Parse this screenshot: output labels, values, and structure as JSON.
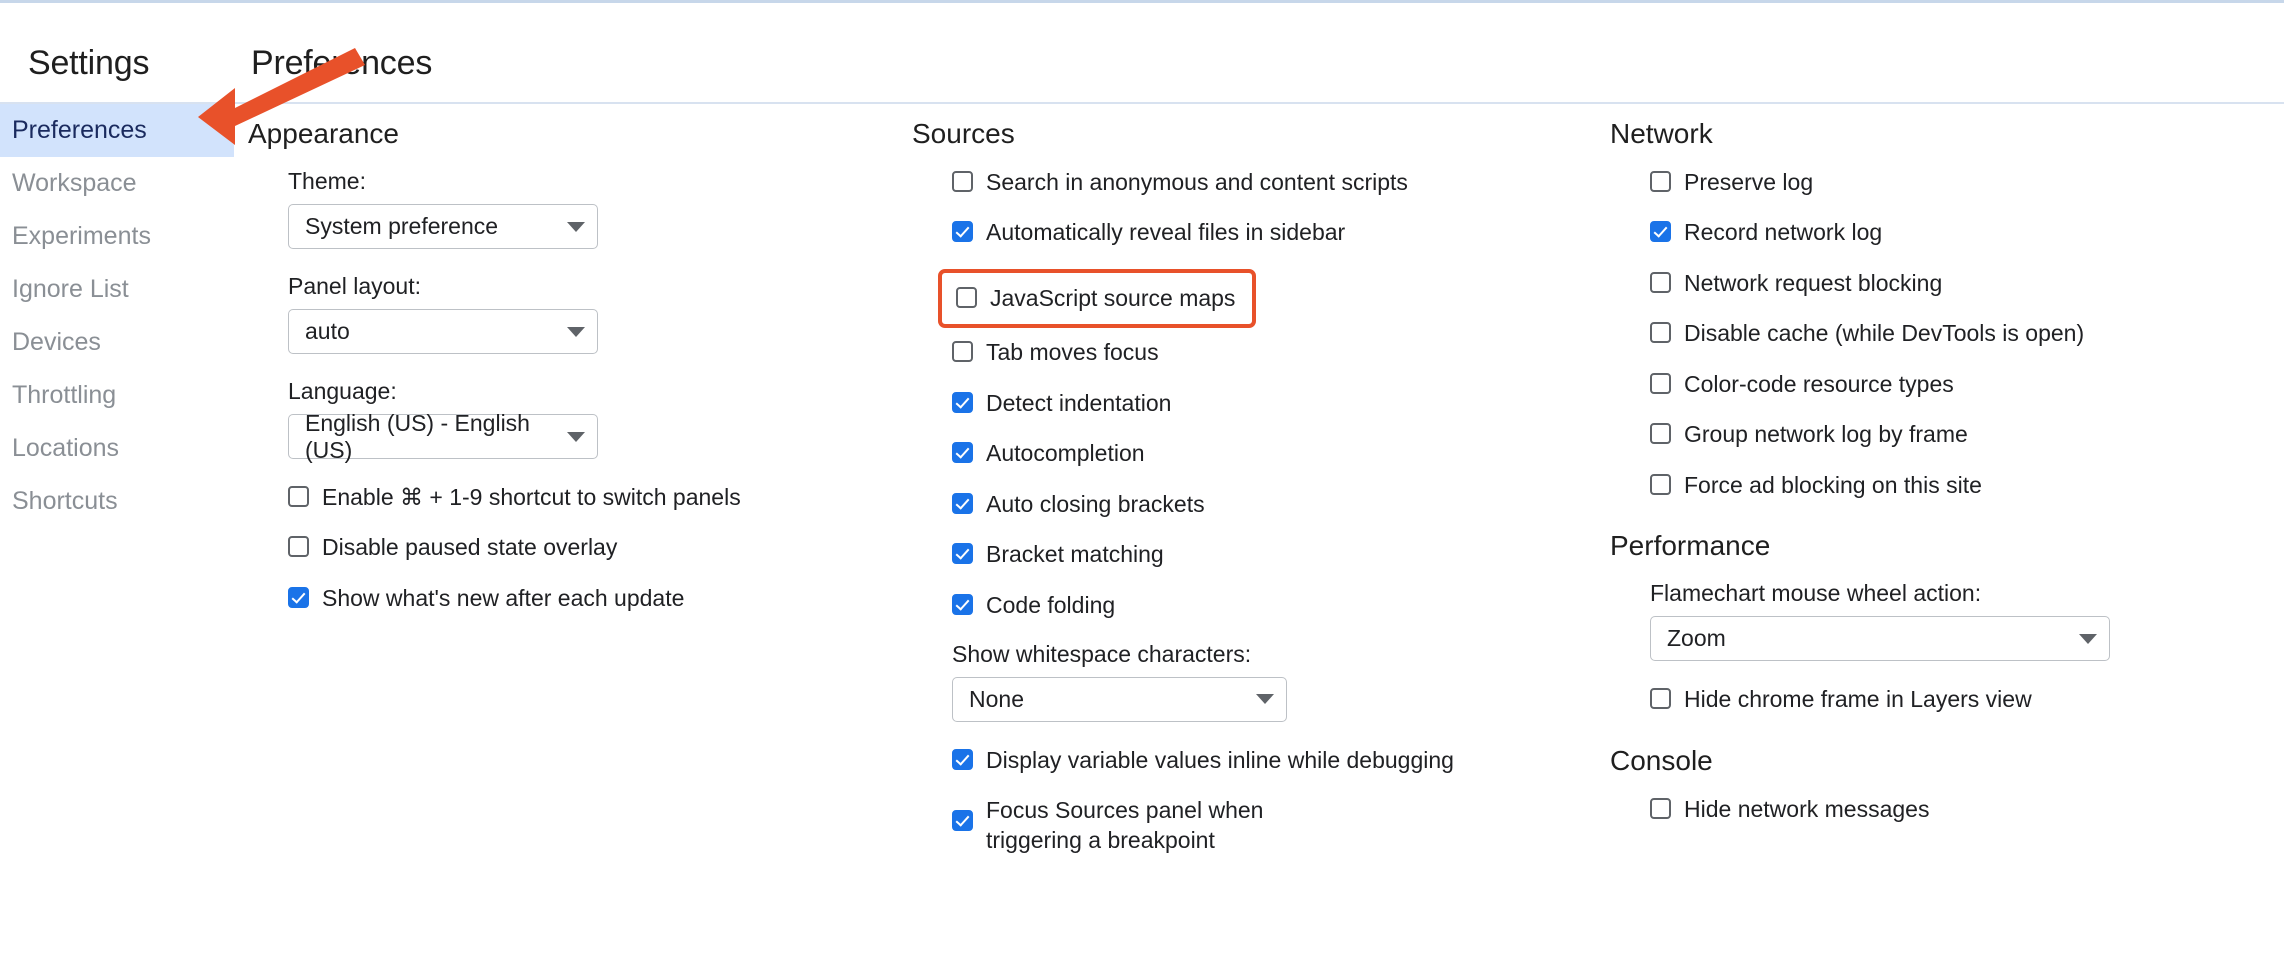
{
  "header": {
    "settings_title": "Settings",
    "page_title": "Preferences"
  },
  "sidebar": {
    "items": [
      {
        "label": "Preferences",
        "active": true
      },
      {
        "label": "Workspace",
        "active": false
      },
      {
        "label": "Experiments",
        "active": false
      },
      {
        "label": "Ignore List",
        "active": false
      },
      {
        "label": "Devices",
        "active": false
      },
      {
        "label": "Throttling",
        "active": false
      },
      {
        "label": "Locations",
        "active": false
      },
      {
        "label": "Shortcuts",
        "active": false
      }
    ]
  },
  "appearance": {
    "heading": "Appearance",
    "theme_label": "Theme:",
    "theme_value": "System preference",
    "panel_layout_label": "Panel layout:",
    "panel_layout_value": "auto",
    "language_label": "Language:",
    "language_value": "English (US) - English (US)",
    "checkboxes": [
      {
        "label": "Enable ⌘ + 1-9 shortcut to switch panels",
        "checked": false
      },
      {
        "label": "Disable paused state overlay",
        "checked": false
      },
      {
        "label": "Show what's new after each update",
        "checked": true
      }
    ]
  },
  "sources": {
    "heading": "Sources",
    "checkboxes_top": [
      {
        "label": "Search in anonymous and content scripts",
        "checked": false
      },
      {
        "label": "Automatically reveal files in sidebar",
        "checked": true
      }
    ],
    "highlighted": {
      "label": "JavaScript source maps",
      "checked": false,
      "highlight_color": "#e8512a"
    },
    "checkboxes_mid": [
      {
        "label": "Tab moves focus",
        "checked": false
      },
      {
        "label": "Detect indentation",
        "checked": true
      },
      {
        "label": "Autocompletion",
        "checked": true
      },
      {
        "label": "Auto closing brackets",
        "checked": true
      },
      {
        "label": "Bracket matching",
        "checked": true
      },
      {
        "label": "Code folding",
        "checked": true
      }
    ],
    "whitespace_label": "Show whitespace characters:",
    "whitespace_value": "None",
    "checkboxes_bottom": [
      {
        "label": "Display variable values inline while debugging",
        "checked": true
      },
      {
        "label": "Focus Sources panel when triggering a breakpoint",
        "checked": true
      }
    ]
  },
  "network": {
    "heading": "Network",
    "checkboxes": [
      {
        "label": "Preserve log",
        "checked": false
      },
      {
        "label": "Record network log",
        "checked": true
      },
      {
        "label": "Network request blocking",
        "checked": false
      },
      {
        "label": "Disable cache (while DevTools is open)",
        "checked": false
      },
      {
        "label": "Color-code resource types",
        "checked": false
      },
      {
        "label": "Group network log by frame",
        "checked": false
      },
      {
        "label": "Force ad blocking on this site",
        "checked": false
      }
    ]
  },
  "performance": {
    "heading": "Performance",
    "flamechart_label": "Flamechart mouse wheel action:",
    "flamechart_value": "Zoom",
    "checkboxes": [
      {
        "label": "Hide chrome frame in Layers view",
        "checked": false
      }
    ]
  },
  "console": {
    "heading": "Console",
    "checkboxes": [
      {
        "label": "Hide network messages",
        "checked": false
      }
    ]
  },
  "annotation": {
    "arrow_color": "#e8512a",
    "arrow_target": "sidebar-item-preferences"
  }
}
